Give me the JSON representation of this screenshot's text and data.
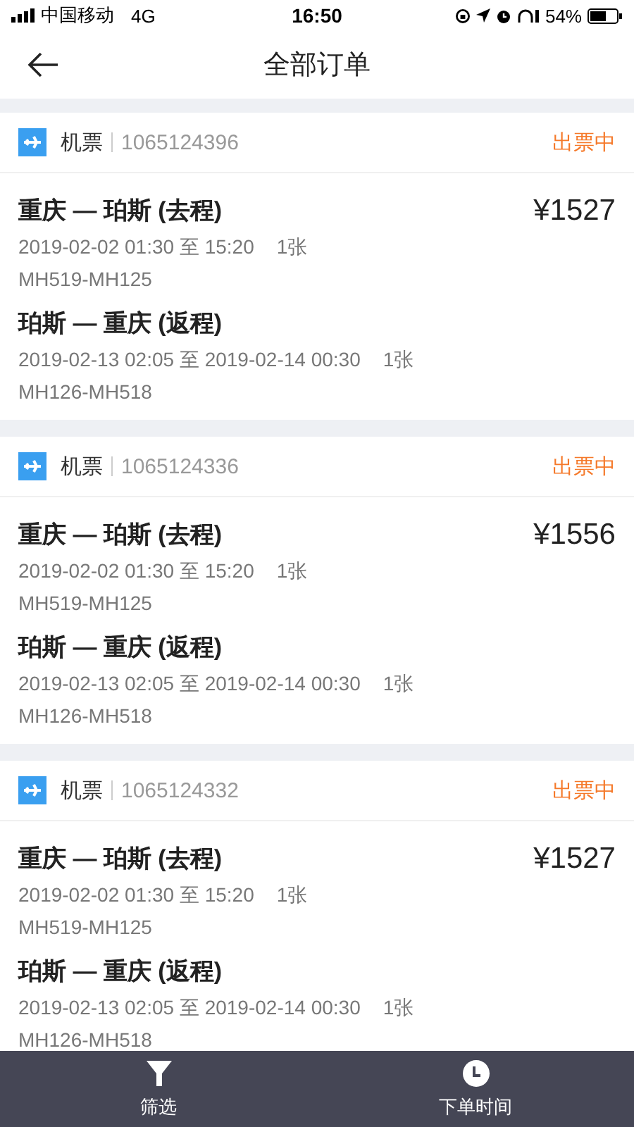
{
  "status_bar": {
    "carrier": "中国移动",
    "network": "4G",
    "time": "16:50",
    "battery": "54%"
  },
  "nav": {
    "title": "全部订单"
  },
  "orders": [
    {
      "type": "机票",
      "number": "1065124396",
      "status": "出票中",
      "price": "¥1527",
      "segments": [
        {
          "route": "重庆 — 珀斯 (去程)",
          "time": "2019-02-02 01:30 至 15:20",
          "count": "1张",
          "flights": "MH519-MH125"
        },
        {
          "route": "珀斯 — 重庆 (返程)",
          "time": "2019-02-13 02:05 至 2019-02-14 00:30",
          "count": "1张",
          "flights": "MH126-MH518"
        }
      ]
    },
    {
      "type": "机票",
      "number": "1065124336",
      "status": "出票中",
      "price": "¥1556",
      "segments": [
        {
          "route": "重庆 — 珀斯 (去程)",
          "time": "2019-02-02 01:30 至 15:20",
          "count": "1张",
          "flights": "MH519-MH125"
        },
        {
          "route": "珀斯 — 重庆 (返程)",
          "time": "2019-02-13 02:05 至 2019-02-14 00:30",
          "count": "1张",
          "flights": "MH126-MH518"
        }
      ]
    },
    {
      "type": "机票",
      "number": "1065124332",
      "status": "出票中",
      "price": "¥1527",
      "segments": [
        {
          "route": "重庆 — 珀斯 (去程)",
          "time": "2019-02-02 01:30 至 15:20",
          "count": "1张",
          "flights": "MH519-MH125"
        },
        {
          "route": "珀斯 — 重庆 (返程)",
          "time": "2019-02-13 02:05 至 2019-02-14 00:30",
          "count": "1张",
          "flights": "MH126-MH518"
        }
      ]
    }
  ],
  "bottom_bar": [
    {
      "kind": "filter",
      "label": "筛选"
    },
    {
      "kind": "time",
      "label": "下单时间"
    }
  ]
}
